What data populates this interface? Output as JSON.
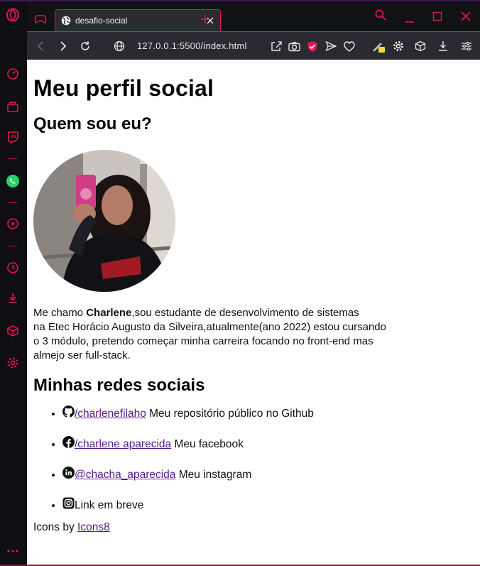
{
  "browser": {
    "tab_title": "desafio-social",
    "url": "127.0.0.1:5500/index.html",
    "accent": "#e3164e"
  },
  "page": {
    "title": "Meu perfil social",
    "about_heading": "Quem sou eu?",
    "bio_prefix": "Me chamo ",
    "bio_name": "Charlene",
    "bio_line1_rest": ",sou estudante de desenvolvimento de sistemas",
    "bio_line2": "na Etec Horácio Augusto da Silveira,atualmente(ano 2022) estou cursando",
    "bio_line3": "o 3 módulo, pretendo começar minha carreira focando no front-end mas",
    "bio_line4": "almejo ser full-stack.",
    "social_heading": "Minhas redes sociais",
    "socials": [
      {
        "icon": "github-icon",
        "link": "/charlenefilaho",
        "text": " Meu repositório público no Github"
      },
      {
        "icon": "facebook-icon",
        "link": "/charlene aparecida",
        "text": " Meu facebook"
      },
      {
        "icon": "linkedin-icon",
        "link": "@chacha_aparecida",
        "text": " Meu instagram"
      },
      {
        "icon": "instagram-icon",
        "link": "",
        "text": "Link em breve"
      }
    ],
    "credit_prefix": "Icons by ",
    "credit_link": "Icons8"
  }
}
